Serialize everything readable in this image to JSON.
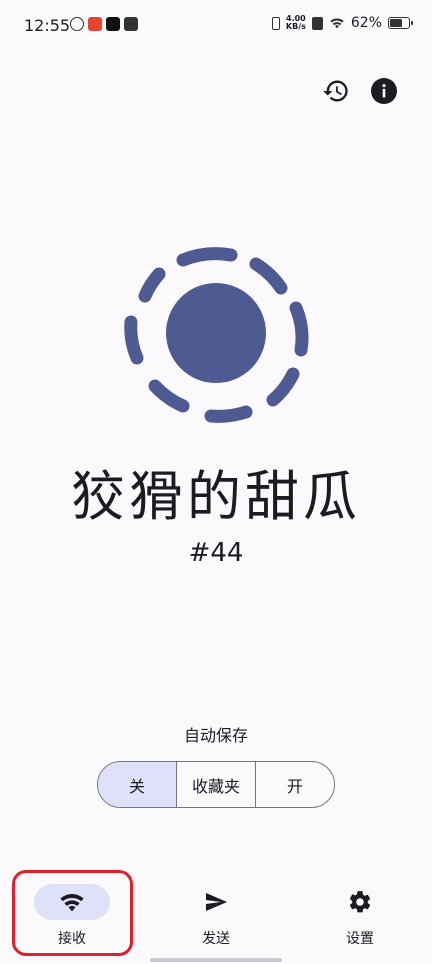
{
  "status_bar": {
    "time": "12:55",
    "net_speed_value": "4.00",
    "net_speed_unit": "KB/s",
    "battery": "62%"
  },
  "header": {
    "history_icon": "history-icon",
    "info_icon": "info-icon"
  },
  "device": {
    "name": "狡猾的甜瓜",
    "id": "#44",
    "avatar_color": "#4e5a92"
  },
  "autosave": {
    "label": "自动保存",
    "options": [
      "关",
      "收藏夹",
      "开"
    ],
    "selected": "关"
  },
  "bottom_nav": {
    "items": [
      {
        "label": "接收",
        "icon": "wifi-icon",
        "active": true
      },
      {
        "label": "发送",
        "icon": "send-icon",
        "active": false
      },
      {
        "label": "设置",
        "icon": "gear-icon",
        "active": false
      }
    ]
  },
  "colors": {
    "accent": "#4e5a92",
    "selected_bg": "#dfe1f9",
    "background": "#fcf9fd",
    "highlight": "#e0202a"
  }
}
